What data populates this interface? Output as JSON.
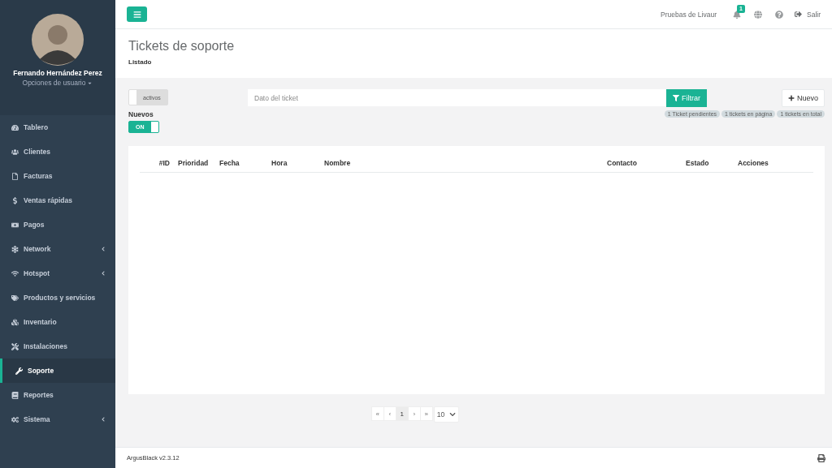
{
  "user": {
    "name": "Fernando Hernández Perez",
    "options": "Opciones de usuario"
  },
  "sidebar": {
    "items": [
      {
        "label": "Tablero",
        "selected": false,
        "submenu": false
      },
      {
        "label": "Clientes",
        "selected": false,
        "submenu": false
      },
      {
        "label": "Facturas",
        "selected": false,
        "submenu": false
      },
      {
        "label": "Ventas rápidas",
        "selected": false,
        "submenu": false
      },
      {
        "label": "Pagos",
        "selected": false,
        "submenu": false
      },
      {
        "label": "Network",
        "selected": false,
        "submenu": true
      },
      {
        "label": "Hotspot",
        "selected": false,
        "submenu": true
      },
      {
        "label": "Productos y servicios",
        "selected": false,
        "submenu": false
      },
      {
        "label": "Inventario",
        "selected": false,
        "submenu": false
      },
      {
        "label": "Instalaciones",
        "selected": false,
        "submenu": false
      },
      {
        "label": "Soporte",
        "selected": true,
        "submenu": false
      },
      {
        "label": "Reportes",
        "selected": false,
        "submenu": false
      },
      {
        "label": "Sistema",
        "selected": false,
        "submenu": true
      }
    ]
  },
  "topbar": {
    "company": "Pruebas de Livaur",
    "notifications": "1",
    "logout": "Salir"
  },
  "page": {
    "title": "Tickets de soporte",
    "subtitle": "Listado"
  },
  "filters": {
    "toggles": [
      {
        "label": "activos",
        "on": false
      },
      {
        "label": "Nuevos",
        "state": "ON",
        "on": true
      }
    ],
    "search": {
      "placeholder": "Dato del ticket"
    },
    "filter_button": "Filtrar",
    "new_button": "Nuevo",
    "badges": [
      "1 Ticket pendientes",
      "1 tickets en página",
      "1 tickets en total"
    ]
  },
  "table": {
    "columns": [
      "#ID",
      "Prioridad",
      "Fecha",
      "Hora",
      "Nombre",
      "Contacto",
      "Estado",
      "Acciones"
    ]
  },
  "pagination": {
    "first": "«",
    "prev": "‹",
    "pages": [
      {
        "label": "1",
        "selected": true
      }
    ],
    "next": "›",
    "last": "»",
    "page_size": "10"
  },
  "footer": {
    "version": "ArgusBlack v2.3.12"
  }
}
